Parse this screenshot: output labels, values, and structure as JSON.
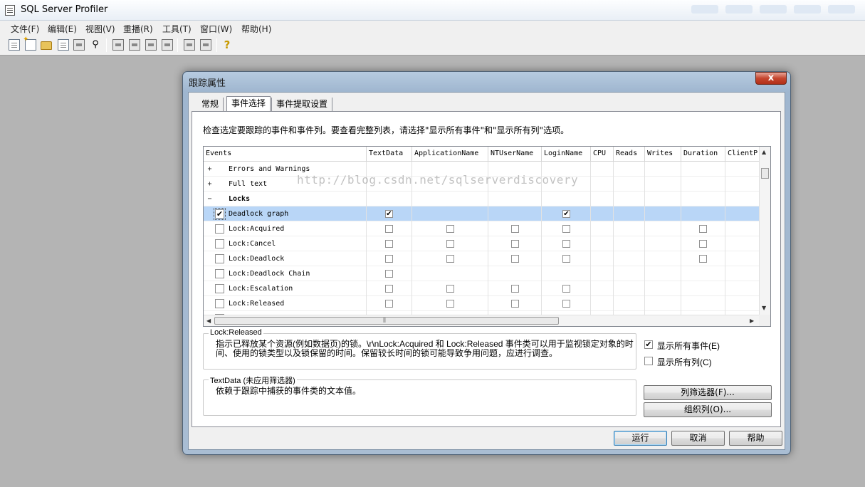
{
  "app": {
    "title": "SQL Server Profiler"
  },
  "menu": [
    "文件(F)",
    "编辑(E)",
    "视图(V)",
    "重播(R)",
    "工具(T)",
    "窗口(W)",
    "帮助(H)"
  ],
  "dialog": {
    "title": "跟踪属性",
    "close_glyph": "x",
    "tabs": [
      "常规",
      "事件选择",
      "事件提取设置"
    ],
    "active_tab": "事件选择",
    "instruction": "检查选定要跟踪的事件和事件列。要查看完整列表，请选择\"显示所有事件\"和\"显示所有列\"选项。",
    "columns": [
      "Events",
      "TextData",
      "ApplicationName",
      "NTUserName",
      "LoginName",
      "CPU",
      "Reads",
      "Writes",
      "Duration",
      "ClientP"
    ],
    "rows": [
      {
        "type": "category",
        "expander": "+",
        "label": "Errors and Warnings"
      },
      {
        "type": "category",
        "expander": "+",
        "label": "Full text"
      },
      {
        "type": "category",
        "expander": "−",
        "label": "Locks",
        "bold": true
      },
      {
        "type": "event",
        "label": "Deadlock graph",
        "checked": true,
        "selected": true,
        "cells": [
          "on",
          "",
          "",
          "on",
          "",
          "",
          "",
          "",
          ""
        ]
      },
      {
        "type": "event",
        "label": "Lock:Acquired",
        "checked": false,
        "cells": [
          "off",
          "off",
          "off",
          "off",
          "",
          "",
          "",
          "off",
          ""
        ]
      },
      {
        "type": "event",
        "label": "Lock:Cancel",
        "checked": false,
        "cells": [
          "off",
          "off",
          "off",
          "off",
          "",
          "",
          "",
          "off",
          ""
        ]
      },
      {
        "type": "event",
        "label": "Lock:Deadlock",
        "checked": false,
        "cells": [
          "off",
          "off",
          "off",
          "off",
          "",
          "",
          "",
          "off",
          ""
        ]
      },
      {
        "type": "event",
        "label": "Lock:Deadlock Chain",
        "checked": false,
        "cells": [
          "off",
          "",
          "",
          "",
          "",
          "",
          "",
          "",
          ""
        ]
      },
      {
        "type": "event",
        "label": "Lock:Escalation",
        "checked": false,
        "cells": [
          "off",
          "off",
          "off",
          "off",
          "",
          "",
          "",
          "",
          ""
        ]
      },
      {
        "type": "event",
        "label": "Lock:Released",
        "checked": false,
        "cells": [
          "off",
          "off",
          "off",
          "off",
          "",
          "",
          "",
          "",
          ""
        ]
      },
      {
        "type": "event",
        "label": "Lock:Timeout",
        "checked": false,
        "partial": true,
        "cells": [
          "off",
          "off",
          "off",
          "off",
          "",
          "",
          "",
          "off",
          ""
        ]
      }
    ],
    "watermark": "http://blog.csdn.net/sqlserverdiscovery",
    "event_desc": {
      "legend": "Lock:Released",
      "line1": "指示已释放某个资源(例如数据页)的锁。\\r\\nLock:Acquired 和 Lock:Released 事件类可以用于监视锁定对象的时",
      "line2": "间、使用的锁类型以及锁保留的时间。保留较长时间的锁可能导致争用问题，应进行调查。"
    },
    "column_desc": {
      "legend": "TextData (未应用筛选器)",
      "line1": "依赖于跟踪中捕获的事件类的文本值。"
    },
    "options": {
      "show_all_events": {
        "label": "显示所有事件(E)",
        "checked": true
      },
      "show_all_columns": {
        "label": "显示所有列(C)",
        "checked": false
      }
    },
    "buttons": {
      "column_filter": "列筛选器(F)...",
      "organize_columns": "组织列(O)...",
      "run": "运行",
      "cancel": "取消",
      "help": "帮助"
    }
  },
  "colors": {
    "selection": "#b9d6f7",
    "workspace": "#b4b4b4",
    "close_button": "#c5452e"
  }
}
